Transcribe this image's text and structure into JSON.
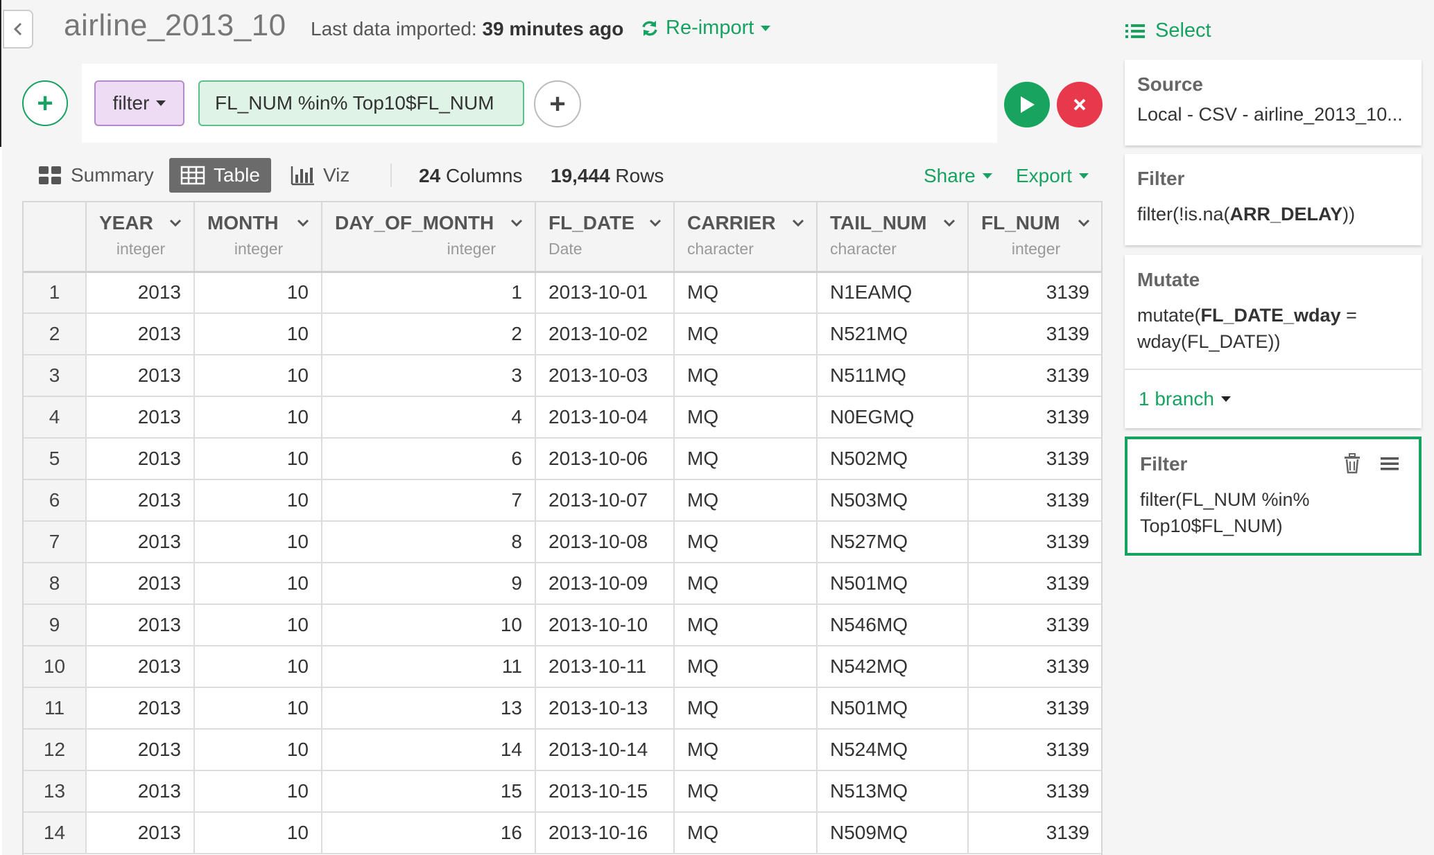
{
  "header": {
    "title": "airline_2013_10",
    "imported_label": "Last data imported:",
    "imported_value": "39 minutes ago",
    "reimport_label": "Re-import"
  },
  "command": {
    "function_label": "filter",
    "expression": "FL_NUM %in% Top10$FL_NUM"
  },
  "toolbar": {
    "tabs": [
      {
        "label": "Summary",
        "icon": "summary-grid-icon"
      },
      {
        "label": "Table",
        "icon": "table-icon"
      },
      {
        "label": "Viz",
        "icon": "bar-chart-icon"
      }
    ],
    "active_tab": "Table",
    "columns_count": "24",
    "columns_label": "Columns",
    "rows_count": "19,444",
    "rows_label": "Rows",
    "share_label": "Share",
    "export_label": "Export"
  },
  "table": {
    "columns": [
      {
        "name": "YEAR",
        "type": "integer"
      },
      {
        "name": "MONTH",
        "type": "integer"
      },
      {
        "name": "DAY_OF_MONTH",
        "type": "integer"
      },
      {
        "name": "FL_DATE",
        "type": "Date"
      },
      {
        "name": "CARRIER",
        "type": "character"
      },
      {
        "name": "TAIL_NUM",
        "type": "character"
      },
      {
        "name": "FL_NUM",
        "type": "integer"
      }
    ],
    "rows": [
      [
        "1",
        "2013",
        "10",
        "1",
        "2013-10-01",
        "MQ",
        "N1EAMQ",
        "3139"
      ],
      [
        "2",
        "2013",
        "10",
        "2",
        "2013-10-02",
        "MQ",
        "N521MQ",
        "3139"
      ],
      [
        "3",
        "2013",
        "10",
        "3",
        "2013-10-03",
        "MQ",
        "N511MQ",
        "3139"
      ],
      [
        "4",
        "2013",
        "10",
        "4",
        "2013-10-04",
        "MQ",
        "N0EGMQ",
        "3139"
      ],
      [
        "5",
        "2013",
        "10",
        "6",
        "2013-10-06",
        "MQ",
        "N502MQ",
        "3139"
      ],
      [
        "6",
        "2013",
        "10",
        "7",
        "2013-10-07",
        "MQ",
        "N503MQ",
        "3139"
      ],
      [
        "7",
        "2013",
        "10",
        "8",
        "2013-10-08",
        "MQ",
        "N527MQ",
        "3139"
      ],
      [
        "8",
        "2013",
        "10",
        "9",
        "2013-10-09",
        "MQ",
        "N501MQ",
        "3139"
      ],
      [
        "9",
        "2013",
        "10",
        "10",
        "2013-10-10",
        "MQ",
        "N546MQ",
        "3139"
      ],
      [
        "10",
        "2013",
        "10",
        "11",
        "2013-10-11",
        "MQ",
        "N542MQ",
        "3139"
      ],
      [
        "11",
        "2013",
        "10",
        "13",
        "2013-10-13",
        "MQ",
        "N501MQ",
        "3139"
      ],
      [
        "12",
        "2013",
        "10",
        "14",
        "2013-10-14",
        "MQ",
        "N524MQ",
        "3139"
      ],
      [
        "13",
        "2013",
        "10",
        "15",
        "2013-10-15",
        "MQ",
        "N513MQ",
        "3139"
      ],
      [
        "14",
        "2013",
        "10",
        "16",
        "2013-10-16",
        "MQ",
        "N509MQ",
        "3139"
      ]
    ]
  },
  "steps": {
    "select_label": "Select",
    "source": {
      "title": "Source",
      "body": "Local - CSV - airline_2013_10..."
    },
    "filter1": {
      "title": "Filter",
      "prefix": "filter(!is.na(",
      "bold": "ARR_DELAY",
      "suffix": "))"
    },
    "mutate": {
      "title": "Mutate",
      "prefix": "mutate(",
      "bold": "FL_DATE_wday",
      "suffix": " = wday(FL_DATE))",
      "branch_label": "1 branch"
    },
    "filter2": {
      "title": "Filter",
      "body": "filter(FL_NUM %in% Top10$FL_NUM)"
    }
  },
  "colors": {
    "accent_green": "#17a261",
    "run_green": "#18a45f",
    "cancel_red": "#e8394c",
    "filter_purple_bg": "#eddcf4"
  }
}
